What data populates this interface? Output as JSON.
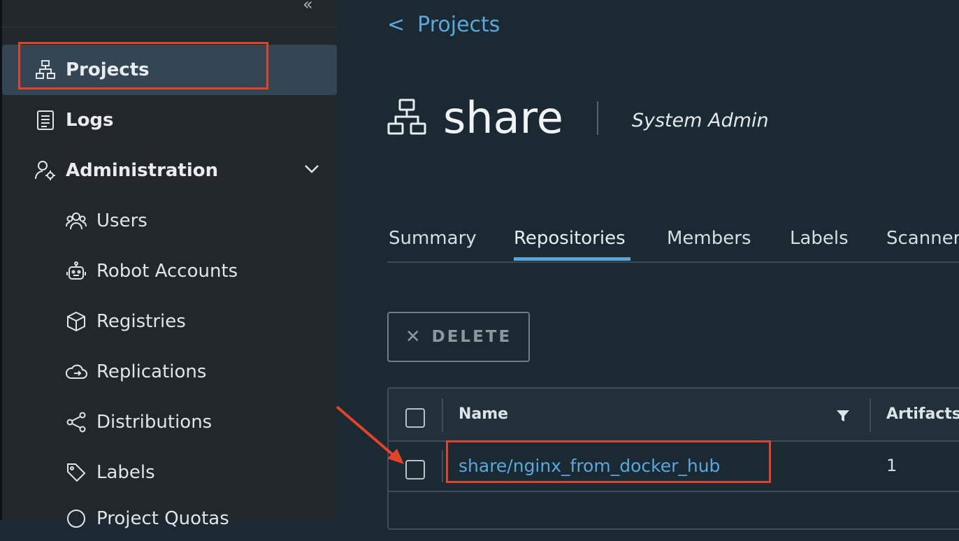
{
  "sidebar": {
    "items": [
      {
        "label": "Projects",
        "icon": "projects-icon"
      },
      {
        "label": "Logs",
        "icon": "logs-icon"
      },
      {
        "label": "Administration",
        "icon": "administration-icon"
      },
      {
        "label": "Users",
        "icon": "users-icon"
      },
      {
        "label": "Robot Accounts",
        "icon": "robot-icon"
      },
      {
        "label": "Registries",
        "icon": "registry-cube-icon"
      },
      {
        "label": "Replications",
        "icon": "replication-cloud-icon"
      },
      {
        "label": "Distributions",
        "icon": "share-nodes-icon"
      },
      {
        "label": "Labels",
        "icon": "tag-icon"
      },
      {
        "label": "Project Quotas",
        "icon": "quota-icon"
      }
    ]
  },
  "breadcrumb": {
    "back": "<",
    "label": "Projects"
  },
  "project": {
    "name": "share",
    "role": "System Admin"
  },
  "tabs": [
    "Summary",
    "Repositories",
    "Members",
    "Labels",
    "Scanner"
  ],
  "toolbar": {
    "delete_label": "DELETE"
  },
  "table": {
    "columns": [
      "Name",
      "Artifacts"
    ],
    "rows": [
      {
        "name": "share/nginx_from_docker_hub",
        "artifacts": "1"
      }
    ]
  },
  "colors": {
    "accent": "#5aa7dc",
    "highlight": "#e2412a",
    "sidebar_active": "#344654"
  }
}
